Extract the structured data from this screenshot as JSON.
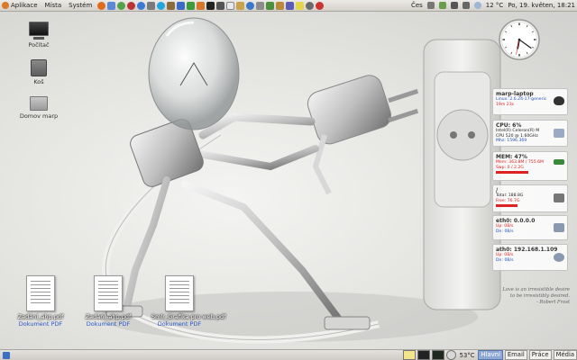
{
  "top_panel": {
    "menus": [
      "Aplikace",
      "Místa",
      "Systém"
    ],
    "language": "Čes",
    "temperature": "12 °C",
    "datetime": "Po, 19. květen, 18:21"
  },
  "desktop": {
    "icons": [
      {
        "label": "Počítač",
        "icon": "computer-icon"
      },
      {
        "label": "Koš",
        "icon": "trash-icon"
      },
      {
        "label": "Domov marp",
        "icon": "home-folder-icon"
      }
    ],
    "pdf_files": [
      {
        "name": "Zadání_ahp.pdf",
        "type": "Dokument PDF"
      },
      {
        "name": "Zadání_ahp.pdf",
        "type": "Dokument PDF"
      },
      {
        "name": "Smlr_Grafika pro web.pdf",
        "type": "Dokument PDF"
      }
    ]
  },
  "sysmon": {
    "host": {
      "title": "marp-laptop",
      "kernel": "Linux: 2.6.24-17-generic",
      "uptime": "19m 23s"
    },
    "cpu": {
      "title": "CPU: 6%",
      "model": "Intel(R) Celeron(R) M",
      "line": "CPU    520 @ 1.60GHz",
      "freq": "Mhz: 1596.369"
    },
    "mem": {
      "title": "MEM: 47%",
      "used": "Mem: 363.8M / 755.6M",
      "swap": "Swp: 0 / 2.2G"
    },
    "disk": {
      "title": "/",
      "total": "Total: 188.8G",
      "free": "Free: 76.7G"
    },
    "eth0": {
      "title": "eth0: 0.0.0.0",
      "up": "Up:  0B/s",
      "down": "Dn:  0B/s"
    },
    "ath0": {
      "title": "ath0: 192.168.1.109",
      "up": "Up:  0B/s",
      "down": "Dn:  0B/s"
    }
  },
  "clock": {
    "hour": 6,
    "minute": 21,
    "second": 32
  },
  "quote": {
    "line1": "Love is an irresistible desire",
    "line2": "to be irresistibly desired.",
    "author": "- Robert Frost"
  },
  "bottom_panel": {
    "temperature": "53°C",
    "workspaces": [
      "Hlavní",
      "Email",
      "Práce",
      "Média"
    ],
    "active_workspace": "Hlavní"
  }
}
